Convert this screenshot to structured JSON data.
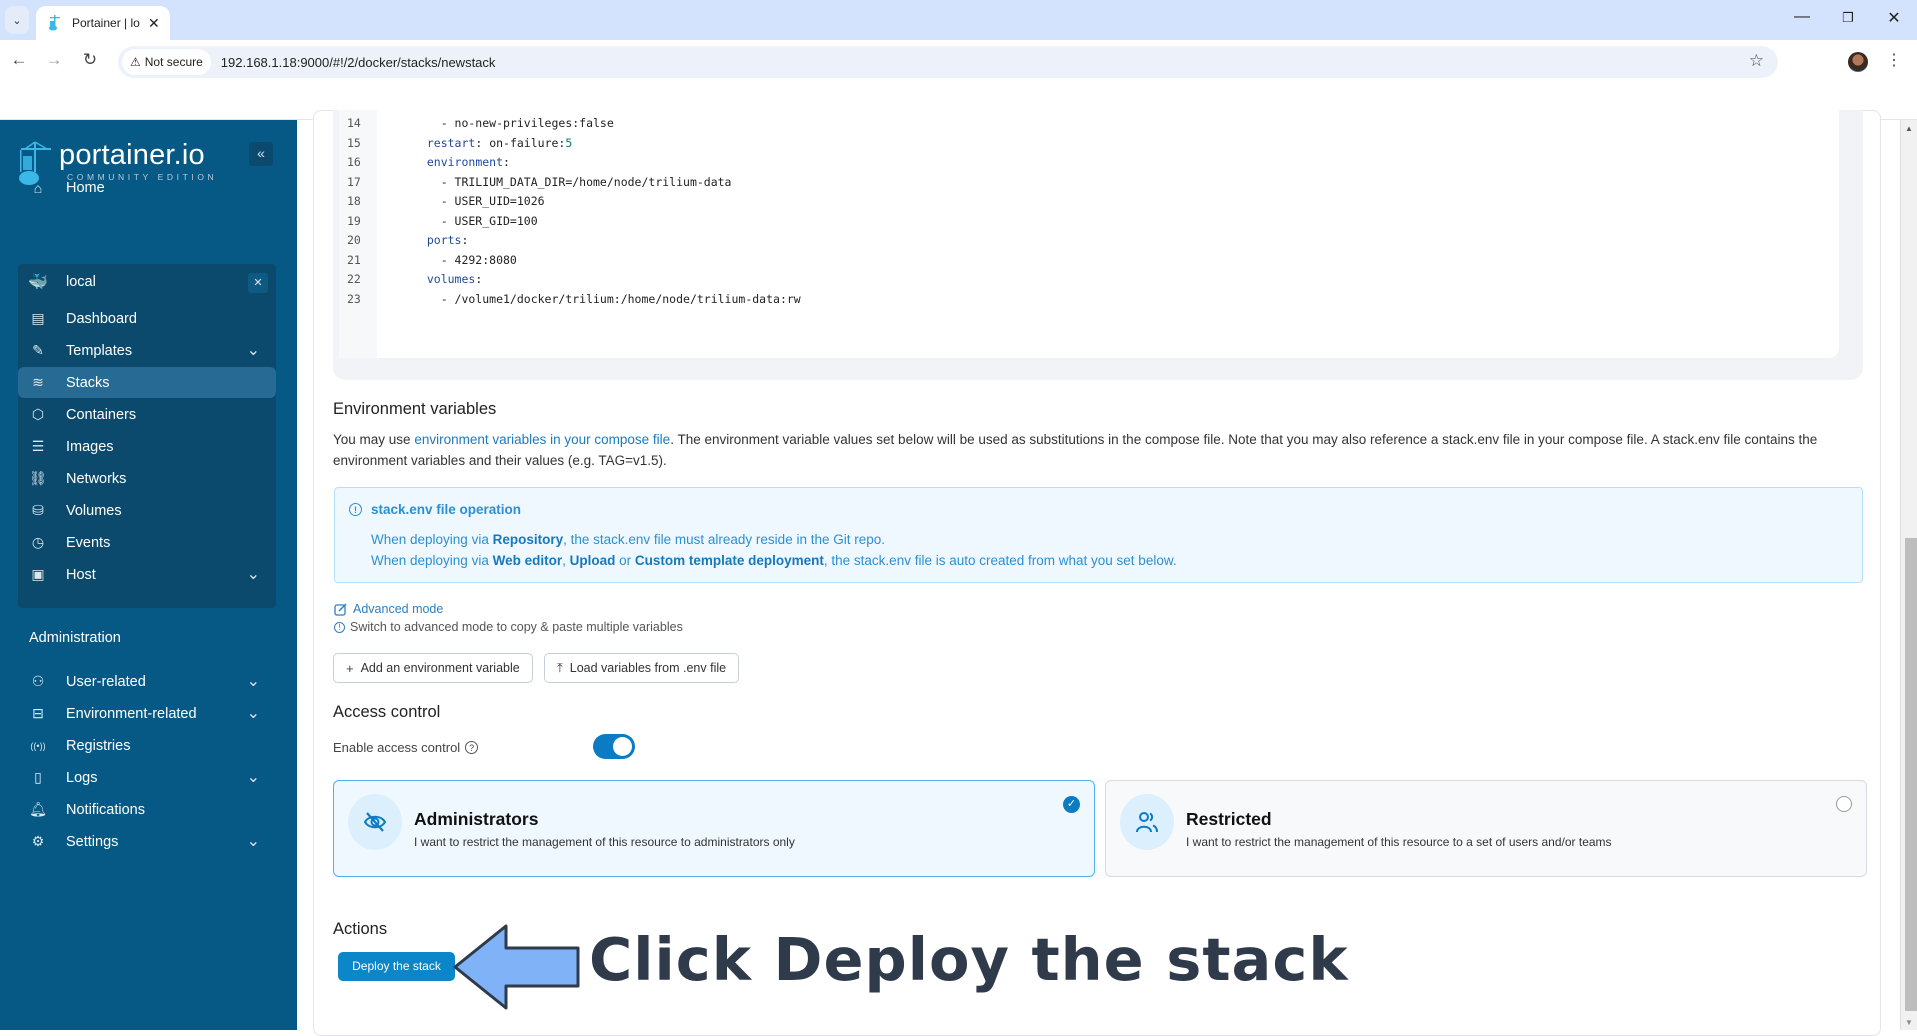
{
  "browser": {
    "tab_title": "Portainer | lo",
    "url": "192.168.1.18:9000/#!/2/docker/stacks/newstack",
    "security_label": "Not secure"
  },
  "sidebar": {
    "logo_text": "portainer.io",
    "logo_subtitle": "COMMUNITY EDITION",
    "collapse_icon": "«",
    "home_label": "Home",
    "environment": {
      "name": "local",
      "items": [
        {
          "label": "Dashboard",
          "icon": "layout-icon",
          "has_chevron": false
        },
        {
          "label": "Templates",
          "icon": "edit-icon",
          "has_chevron": true
        },
        {
          "label": "Stacks",
          "icon": "layers-icon",
          "has_chevron": false,
          "active": true
        },
        {
          "label": "Containers",
          "icon": "box-icon",
          "has_chevron": false
        },
        {
          "label": "Images",
          "icon": "list-icon",
          "has_chevron": false
        },
        {
          "label": "Networks",
          "icon": "network-icon",
          "has_chevron": false
        },
        {
          "label": "Volumes",
          "icon": "database-icon",
          "has_chevron": false
        },
        {
          "label": "Events",
          "icon": "clock-icon",
          "has_chevron": false
        },
        {
          "label": "Host",
          "icon": "server-icon",
          "has_chevron": true
        }
      ]
    },
    "admin_section_label": "Administration",
    "admin_items": [
      {
        "label": "User-related",
        "icon": "users-icon",
        "has_chevron": true
      },
      {
        "label": "Environment-related",
        "icon": "hard-drive-icon",
        "has_chevron": true
      },
      {
        "label": "Registries",
        "icon": "radio-icon",
        "has_chevron": false
      },
      {
        "label": "Logs",
        "icon": "file-text-icon",
        "has_chevron": true
      },
      {
        "label": "Notifications",
        "icon": "bell-icon",
        "has_chevron": false
      },
      {
        "label": "Settings",
        "icon": "settings-icon",
        "has_chevron": true
      }
    ]
  },
  "editor": {
    "lines": [
      {
        "n": "14",
        "text": "    - no-new-privileges:false"
      },
      {
        "n": "15",
        "text": "  restart: on-failure:5"
      },
      {
        "n": "16",
        "text": "  environment:"
      },
      {
        "n": "17",
        "text": "    - TRILIUM_DATA_DIR=/home/node/trilium-data"
      },
      {
        "n": "18",
        "text": "    - USER_UID=1026"
      },
      {
        "n": "19",
        "text": "    - USER_GID=100"
      },
      {
        "n": "20",
        "text": "  ports:"
      },
      {
        "n": "21",
        "text": "    - 4292:8080"
      },
      {
        "n": "22",
        "text": "  volumes:"
      },
      {
        "n": "23",
        "text": "    - /volume1/docker/trilium:/home/node/trilium-data:rw"
      }
    ]
  },
  "env_vars": {
    "title": "Environment variables",
    "desc_prefix": "You may use ",
    "desc_link": "environment variables in your compose file",
    "desc_suffix": ". The environment variable values set below will be used as substitutions in the compose file. Note that you may also reference a stack.env file in your compose file. A stack.env file contains the environment variables and their values (e.g. TAG=v1.5).",
    "info_title": "stack.env file operation",
    "info_line1": {
      "pre": "When deploying via ",
      "b1": "Repository",
      "post": ", the stack.env file must already reside in the Git repo."
    },
    "info_line2": {
      "pre": "When deploying via ",
      "b1": "Web editor",
      "sep1": ", ",
      "b2": "Upload",
      "sep2": " or ",
      "b3": "Custom template deployment",
      "post": ", the stack.env file is auto created from what you set below."
    },
    "advanced_mode_label": "Advanced mode",
    "advanced_hint": "Switch to advanced mode to copy & paste multiple variables",
    "add_button": "Add an environment variable",
    "load_button": "Load variables from .env file"
  },
  "access_control": {
    "title": "Access control",
    "enable_label": "Enable access control",
    "enabled": true,
    "options": [
      {
        "title": "Administrators",
        "desc": "I want to restrict the management of this resource to administrators only",
        "selected": true
      },
      {
        "title": "Restricted",
        "desc": "I want to restrict the management of this resource to a set of users and/or teams",
        "selected": false
      }
    ]
  },
  "actions": {
    "title": "Actions",
    "deploy_button": "Deploy the stack"
  },
  "annotation": {
    "text": "Click Deploy the stack",
    "arrow_color": "#7fb2f7"
  },
  "colors": {
    "sidebar_bg": "#075985",
    "accent": "#0b7bc4",
    "info_text": "#2b8fd2"
  }
}
